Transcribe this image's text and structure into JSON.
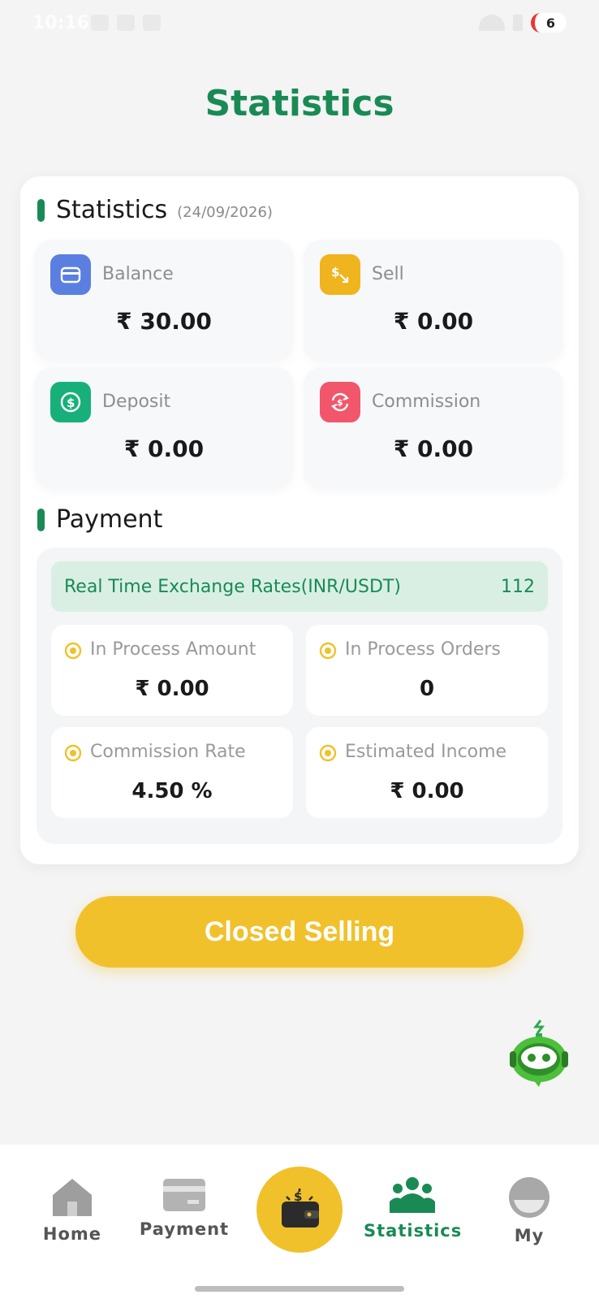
{
  "status_bar": {
    "time": "10:16",
    "notification_count": "6"
  },
  "page_title": "Statistics",
  "statistics": {
    "title": "Statistics",
    "date": "(24/09/2026)",
    "tiles": [
      {
        "label": "Balance",
        "value": "₹ 30.00",
        "color": "#5b7fe0",
        "icon": "wallet-icon"
      },
      {
        "label": "Sell",
        "value": "₹ 0.00",
        "color": "#f0b41f",
        "icon": "sell-icon"
      },
      {
        "label": "Deposit",
        "value": "₹ 0.00",
        "color": "#18b07a",
        "icon": "dollar-coin-icon"
      },
      {
        "label": "Commission",
        "value": "₹ 0.00",
        "color": "#f2566a",
        "icon": "exchange-icon"
      }
    ]
  },
  "payment": {
    "title": "Payment",
    "rate_label": "Real Time Exchange Rates(INR/USDT)",
    "rate_value": "112",
    "tiles": [
      {
        "label": "In Process Amount",
        "value": "₹ 0.00"
      },
      {
        "label": "In Process Orders",
        "value": "0"
      },
      {
        "label": "Commission Rate",
        "value": "4.50 %"
      },
      {
        "label": "Estimated Income",
        "value": "₹ 0.00"
      }
    ]
  },
  "closed_button": "Closed Selling",
  "nav": {
    "home": "Home",
    "payment": "Payment",
    "statistics": "Statistics",
    "my": "My",
    "active": "statistics"
  },
  "colors": {
    "accent_green": "#1a8a55",
    "accent_yellow": "#f0c12b",
    "rate_bg": "#d9efe4"
  }
}
